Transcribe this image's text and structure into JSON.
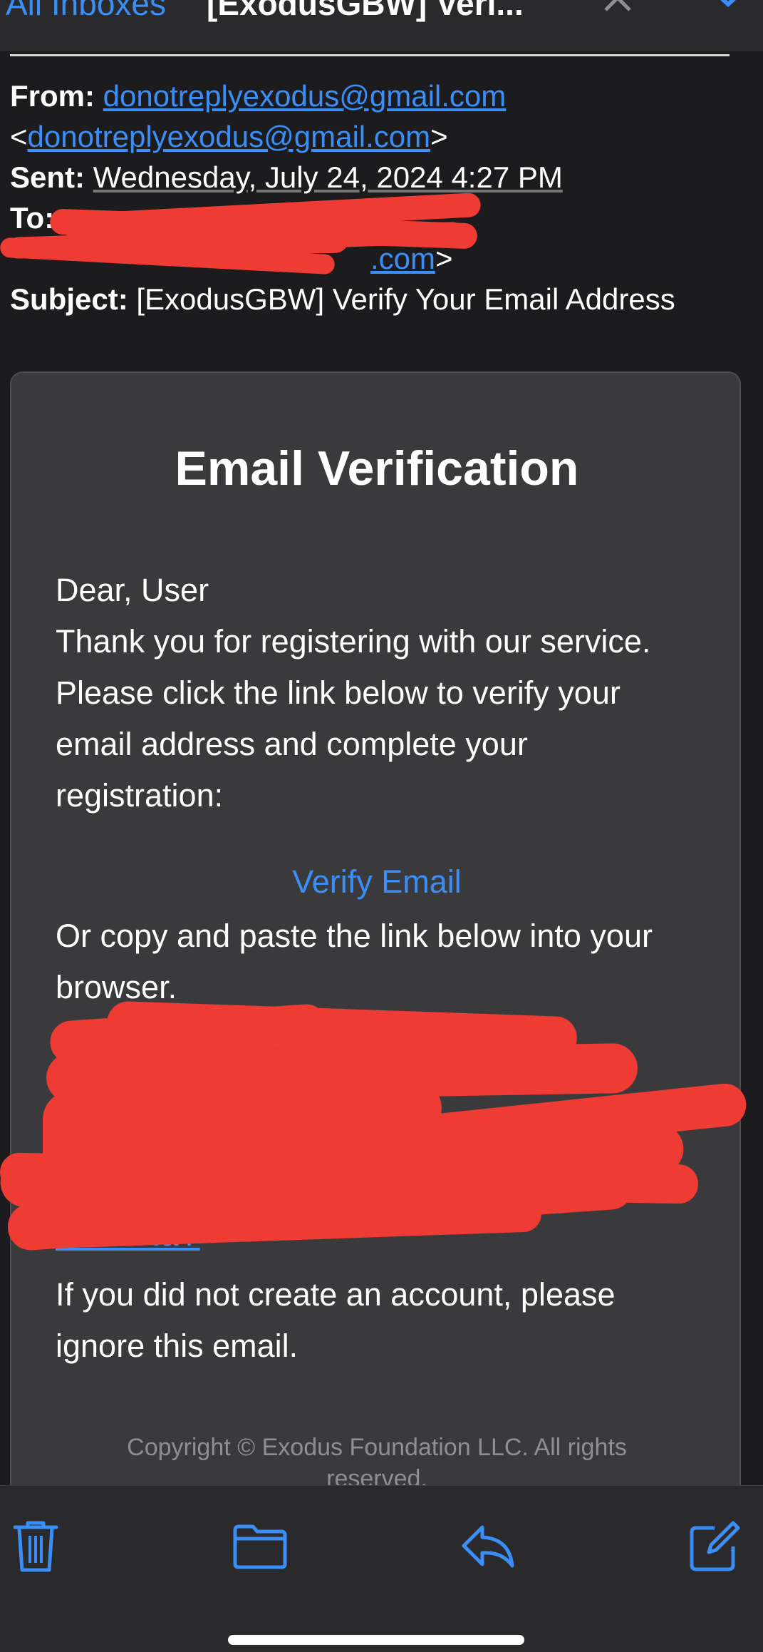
{
  "nav": {
    "back_label": "All Inboxes",
    "title": "[ExodusGBW] Veri..."
  },
  "header": {
    "from_label": "From:",
    "from_email": "donotreplyexodus@gmail.com",
    "from_email_bracket": "donotreplyexodus@gmail.com",
    "sent_label": "Sent:",
    "sent_value": "Wednesday, July 24, 2024 4:27 PM",
    "to_label": "To:",
    "to_email_tail": ".com",
    "subject_label": "Subject:",
    "subject_value": "[ExodusGBW] Verify Your Email Address"
  },
  "card": {
    "title": "Email Verification",
    "greeting": "Dear, User",
    "intro_line1": "Thank you for registering with our service.",
    "intro_line2": "Please click the link below to verify your",
    "intro_line3": "email address and complete your",
    "intro_line4": "registration:",
    "verify_link": "Verify Email",
    "copy_line1": "Or copy and paste the link below into your",
    "copy_line2": "browser.",
    "url_tail": "aDlocNaY",
    "ignore_line1": "If you did not create an account, please",
    "ignore_line2": "ignore this email.",
    "copyright_line1": "Copyright © Exodus Foundation LLC. All rights",
    "copyright_line2": "reserved."
  },
  "toolbar": {
    "icons": [
      "trash-icon",
      "folder-icon",
      "reply-icon",
      "compose-icon"
    ]
  },
  "colors": {
    "background": "#1c1c1e",
    "card": "#3a3a3c",
    "link": "#3a8ef6",
    "redaction": "#ee3b33",
    "muted_text": "#8e8e93"
  }
}
